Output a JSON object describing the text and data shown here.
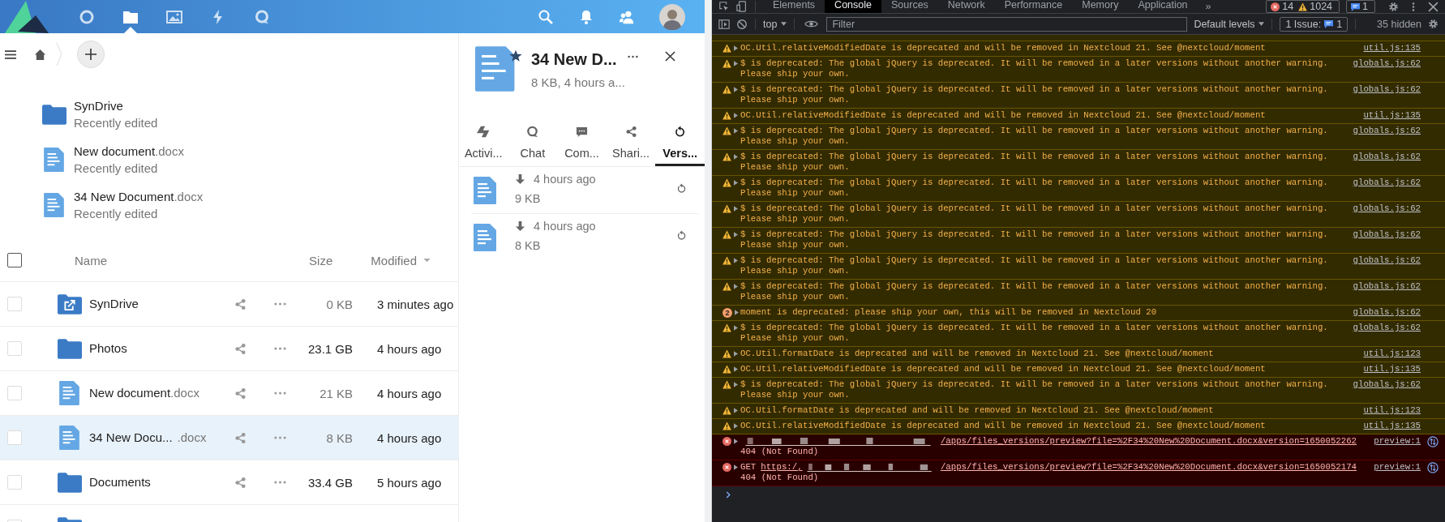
{
  "app": {
    "nav": [
      {
        "kind": "dashboard",
        "selected": false
      },
      {
        "kind": "files",
        "selected": true
      },
      {
        "kind": "photos",
        "selected": false
      },
      {
        "kind": "activity",
        "selected": false
      },
      {
        "kind": "talk",
        "selected": false
      }
    ],
    "recent": [
      {
        "kind": "folder",
        "name": "SynDrive",
        "subtitle": "Recently edited"
      },
      {
        "kind": "document",
        "name": "New document",
        "ext": ".docx",
        "subtitle": "Recently edited"
      },
      {
        "kind": "document",
        "name": "34 New Document",
        "ext": ".docx",
        "subtitle": "Recently edited"
      }
    ],
    "table": {
      "checked": false,
      "columns": [
        {
          "label": "Name",
          "sorted": false
        },
        {
          "label": "Size",
          "sorted": false
        },
        {
          "label": "Modified",
          "sorted": true
        }
      ],
      "rows": [
        {
          "kind": "shared_folder",
          "name": "SynDrive",
          "size": "0 KB",
          "large": false,
          "modified": "3 minutes ago",
          "selected": false,
          "checked": false
        },
        {
          "kind": "folder",
          "name": "Photos",
          "size": "23.1 GB",
          "large": true,
          "modified": "4 hours ago",
          "selected": false,
          "checked": false
        },
        {
          "kind": "document",
          "name": "New document",
          "ext": ".docx",
          "size": "21 KB",
          "large": false,
          "modified": "4 hours ago",
          "selected": false,
          "checked": false
        },
        {
          "kind": "document",
          "name": "34 New Docu...",
          "ext": ".docx",
          "size": "8 KB",
          "large": false,
          "modified": "4 hours ago",
          "selected": true,
          "checked": false
        },
        {
          "kind": "folder",
          "name": "Documents",
          "size": "33.4 GB",
          "large": true,
          "modified": "5 hours ago",
          "selected": false,
          "checked": false
        },
        {
          "kind": "folder",
          "selected": false,
          "checked": false
        }
      ]
    },
    "sidebar": {
      "title": "34 New D...",
      "subtitle": "8 KB, 4 hours a...",
      "starred": true,
      "tabs": [
        {
          "kind": "activity",
          "label": "Activi...",
          "selected": false
        },
        {
          "kind": "chat",
          "label": "Chat",
          "selected": false
        },
        {
          "kind": "comments",
          "label": "Com...",
          "selected": false
        },
        {
          "kind": "sharing",
          "label": "Shari...",
          "selected": false
        },
        {
          "kind": "versions",
          "label": "Vers...",
          "selected": true
        }
      ],
      "versions": [
        {
          "time": "4 hours ago",
          "size": "9 KB"
        },
        {
          "time": "4 hours ago",
          "size": "8 KB"
        }
      ]
    }
  },
  "devtools": {
    "tabs": [
      {
        "label": "Elements",
        "selected": false
      },
      {
        "label": "Console",
        "selected": true
      },
      {
        "label": "Sources",
        "selected": false
      },
      {
        "label": "Network",
        "selected": false
      },
      {
        "label": "Performance",
        "selected": false
      },
      {
        "label": "Memory",
        "selected": false
      },
      {
        "label": "Application",
        "selected": false
      }
    ],
    "more": "»",
    "errors": "14",
    "warnings": "1024",
    "messages": "1",
    "context": "top",
    "filter_placeholder": "Filter",
    "levels": "Default levels",
    "issues_label": "1 Issue:",
    "issues_count": "1",
    "hidden": "35 hidden",
    "log": [
      {
        "kind": "warning",
        "text": "OC.Util.relativeModifiedDate is deprecated and will be removed in Nextcloud 21. See @nextcloud/moment",
        "source": "util.js:135"
      },
      {
        "kind": "warning",
        "text": "$ is deprecated: The global jQuery is deprecated. It will be removed in a later versions without another warning. Please ship your own.",
        "source": "globals.js:62"
      },
      {
        "kind": "warning",
        "text": "$ is deprecated: The global jQuery is deprecated. It will be removed in a later versions without another warning. Please ship your own.",
        "source": "globals.js:62"
      },
      {
        "kind": "warning",
        "text": "OC.Util.relativeModifiedDate is deprecated and will be removed in Nextcloud 21. See @nextcloud/moment",
        "source": "util.js:135"
      },
      {
        "kind": "warning",
        "text": "$ is deprecated: The global jQuery is deprecated. It will be removed in a later versions without another warning. Please ship your own.",
        "source": "globals.js:62"
      },
      {
        "kind": "warning",
        "text": "$ is deprecated: The global jQuery is deprecated. It will be removed in a later versions without another warning. Please ship your own.",
        "source": "globals.js:62"
      },
      {
        "kind": "warning",
        "text": "$ is deprecated: The global jQuery is deprecated. It will be removed in a later versions without another warning. Please ship your own.",
        "source": "globals.js:62"
      },
      {
        "kind": "warning",
        "text": "$ is deprecated: The global jQuery is deprecated. It will be removed in a later versions without another warning. Please ship your own.",
        "source": "globals.js:62"
      },
      {
        "kind": "warning",
        "text": "$ is deprecated: The global jQuery is deprecated. It will be removed in a later versions without another warning. Please ship your own.",
        "source": "globals.js:62"
      },
      {
        "kind": "warning",
        "text": "$ is deprecated: The global jQuery is deprecated. It will be removed in a later versions without another warning. Please ship your own.",
        "source": "globals.js:62"
      },
      {
        "kind": "warning",
        "text": "$ is deprecated: The global jQuery is deprecated. It will be removed in a later versions without another warning. Please ship your own.",
        "source": "globals.js:62"
      },
      {
        "kind": "warning",
        "repeat": "2",
        "text": "moment is deprecated: please ship your own, this will be removed in Nextcloud 20",
        "source": "globals.js:62"
      },
      {
        "kind": "warning",
        "text": "$ is deprecated: The global jQuery is deprecated. It will be removed in a later versions without another warning. Please ship your own.",
        "source": "globals.js:62"
      },
      {
        "kind": "warning",
        "text": "OC.Util.formatDate is deprecated and will be removed in Nextcloud 21. See @nextcloud/moment",
        "source": "util.js:123"
      },
      {
        "kind": "warning",
        "text": "OC.Util.relativeModifiedDate is deprecated and will be removed in Nextcloud 21. See @nextcloud/moment",
        "source": "util.js:135"
      },
      {
        "kind": "warning",
        "text": "$ is deprecated: The global jQuery is deprecated. It will be removed in a later versions without another warning. Please ship your own.",
        "source": "globals.js:62"
      },
      {
        "kind": "warning",
        "text": "OC.Util.formatDate is deprecated and will be removed in Nextcloud 21. See @nextcloud/moment",
        "source": "util.js:123"
      },
      {
        "kind": "warning",
        "text": "OC.Util.relativeModifiedDate is deprecated and will be removed in Nextcloud 21. See @nextcloud/moment",
        "source": "util.js:135"
      },
      {
        "kind": "error",
        "url": "/apps/files_versions/preview?file=%2F34%20New%20Document.docx&version=1650052262",
        "status": "404 (Not Found)",
        "source": "preview:1"
      },
      {
        "kind": "error",
        "method": "GET",
        "host": "https:/,",
        "url": "/apps/files_versions/preview?file=%2F34%20New%20Document.docx&version=1650052174",
        "status": "404 (Not Found)",
        "source": "preview:1"
      }
    ]
  }
}
